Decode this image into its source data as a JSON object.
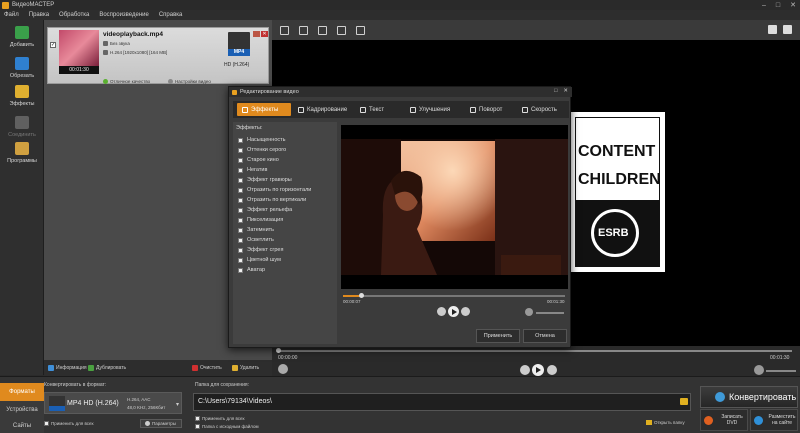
{
  "app": {
    "title": "ВидеоМАСТЕР",
    "window_controls": [
      "–",
      "□",
      "✕"
    ]
  },
  "menu": [
    "Файл",
    "Правка",
    "Обработка",
    "Воспроизведение",
    "Справка"
  ],
  "sidebar": {
    "items": [
      {
        "label": "Добавить",
        "icon": "add-file-icon",
        "color": "#3aa04a",
        "enabled": true
      },
      {
        "label": "Обрезать",
        "icon": "trim-icon",
        "color": "#2f80d0",
        "enabled": true
      },
      {
        "label": "Эффекты",
        "icon": "effects-icon",
        "color": "#e0b030",
        "enabled": true
      },
      {
        "label": "Соединить",
        "icon": "join-icon",
        "color": "#606060",
        "enabled": false
      },
      {
        "label": "Программы",
        "icon": "programs-icon",
        "color": "#d0a040",
        "enabled": true
      }
    ]
  },
  "file": {
    "name": "videoplayback.mp4",
    "audio": "Без звука",
    "video": "H.264 [1920x1080] [164 MB]",
    "duration": "00:01:30",
    "quality_label": "Отличное качество",
    "settings_label": "Настройки видео",
    "target_format": "MP4",
    "target_label": "HD (H.264)"
  },
  "list_actions": {
    "info": "Информация",
    "duplicate": "Дублировать",
    "clear": "Очистить",
    "delete": "Удалить"
  },
  "main_player": {
    "time_current": "00:00:00",
    "time_total": "00:01:30"
  },
  "preview": {
    "esrb_line1": "CONTENT",
    "esrb_line2": "CHILDREN",
    "esrb_logo": "ESRB"
  },
  "dialog": {
    "title": "Редактирование видео",
    "tabs": [
      {
        "label": "Эффекты",
        "icon": "effects-tab-icon",
        "active": true
      },
      {
        "label": "Кадрирование",
        "icon": "crop-icon",
        "active": false
      },
      {
        "label": "Текст",
        "icon": "text-icon",
        "active": false
      },
      {
        "label": "Улучшения",
        "icon": "enhance-icon",
        "active": false
      },
      {
        "label": "Поворот",
        "icon": "rotate-icon",
        "active": false
      },
      {
        "label": "Скорость",
        "icon": "speed-icon",
        "active": false
      }
    ],
    "effects_heading": "Эффекты:",
    "effects": [
      "Насыщенность",
      "Оттенки серого",
      "Старое кино",
      "Негатив",
      "Эффект гравюры",
      "Отразить по горизонтали",
      "Отразить по вертикали",
      "Эффект рельефа",
      "Пикселизация",
      "Затемнить",
      "Осветлить",
      "Эффект сгрея",
      "Цветной шум",
      "Аватар"
    ],
    "time_current": "00:00:07",
    "time_total": "00:01:30",
    "progress": 0.08,
    "apply_label": "Применить",
    "cancel_label": "Отмена"
  },
  "bottom": {
    "tabs": [
      {
        "label": "Форматы",
        "active": true
      },
      {
        "label": "Устройства",
        "active": false
      },
      {
        "label": "Сайты",
        "active": false
      }
    ],
    "convert_to_label": "Конвертировать в формат:",
    "format_name": "MP4 HD (H.264)",
    "format_spec_video": "H.264, AAC",
    "format_spec_audio": "48,0 KHz, 256Кбит",
    "apply_all_label": "Применить для всех",
    "params_label": "Параметры",
    "save_folder_label": "Папка для сохранения:",
    "save_path": "C:\\Users\\79134\\Videos\\",
    "save_apply_all": "Применить для всех",
    "save_source_folder": "Папка с исходным файлом",
    "open_folder": "Открыть папку",
    "convert_label": "Конвертировать",
    "dvd_label": "Записать DVD",
    "web_label": "Разместить на сайте"
  }
}
